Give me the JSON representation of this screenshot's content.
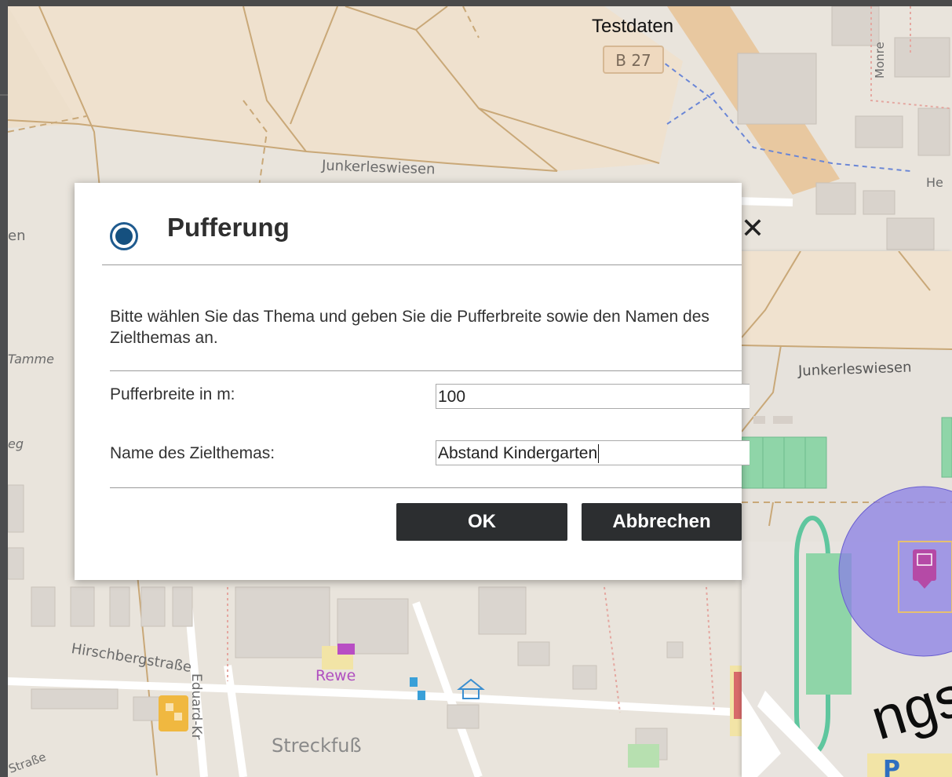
{
  "map": {
    "overlay_label": "Testdaten",
    "road_shield": "B 27",
    "street_labels": {
      "junkerleswiesen": "Junkerleswiesen",
      "hirschbergstrasse": "Hirschbergstraße",
      "eduard": "Eduard-Kr",
      "strasse": "Straße",
      "streckfuss": "Streckfuß",
      "tamme": "Tamme",
      "monre": "Monre",
      "he": "He",
      "en": "en",
      "eg": "eg"
    },
    "poi": {
      "rewe": "Rewe"
    },
    "colors": {
      "land": "#e9e4dc",
      "residential": "#f0e2cf",
      "road_brown": "#c9a878",
      "building": "#dad5cf",
      "buffer": "#8a7fe6"
    }
  },
  "inset": {
    "street_label": "Junkerleswiesen",
    "watermark": "ngsarbe"
  },
  "dialog": {
    "title": "Pufferung",
    "close_icon": "✕",
    "description": "Bitte wählen Sie das Thema und geben Sie die Pufferbreite sowie den Namen des Zielthemas an.",
    "buffer_width_label": "Pufferbreite in m:",
    "buffer_width_value": "100",
    "target_name_label": "Name des Zielthemas:",
    "target_name_value": "Abstand Kindergarten",
    "ok_label": "OK",
    "cancel_label": "Abbrechen",
    "colors": {
      "accent": "#15507f",
      "button": "#2c2e30"
    }
  }
}
